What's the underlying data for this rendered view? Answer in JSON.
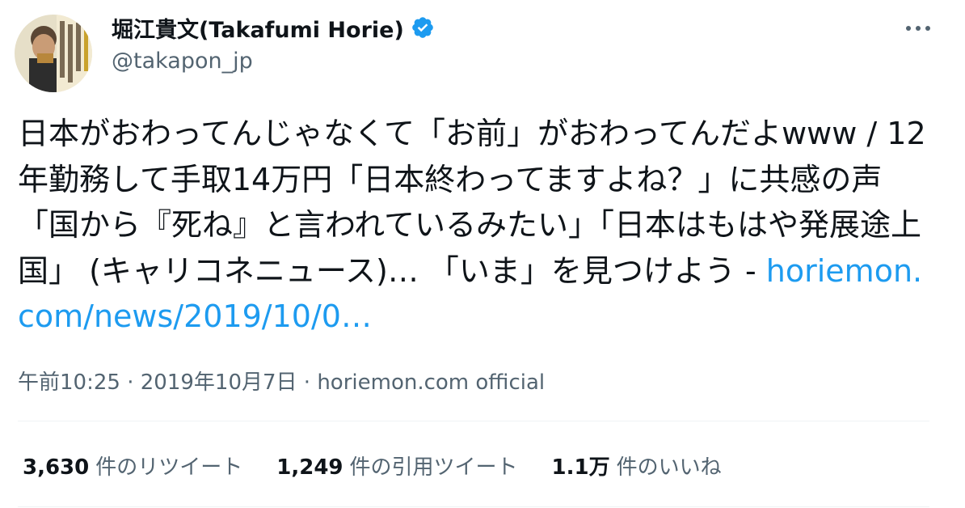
{
  "author": {
    "display_name": "堀江貴文(Takafumi Horie)",
    "handle": "@takapon_jp",
    "verified": true,
    "avatar_icon": "profile-photo-book-cover"
  },
  "tweet": {
    "text": "日本がおわってんじゃなくて「お前」がおわってんだよwww / 12年勤務して手取14万円「日本終わってますよね？」に共感の声　「国から『死ね』と言われているみたい」「日本はもはや発展途上国」 (キャリコネニュース)… 「いま」を見つけよう - ",
    "link_text": "horiemon.com/news/2019/10/0…"
  },
  "meta": {
    "time": "午前10:25",
    "separator1": " · ",
    "date": "2019年10月7日",
    "separator2": " · ",
    "source": "horiemon.com official"
  },
  "stats": {
    "retweets": {
      "count": "3,630",
      "label": "件のリツイート"
    },
    "quotes": {
      "count": "1,249",
      "label": "件の引用ツイート"
    },
    "likes": {
      "count": "1.1万",
      "label": "件のいいね"
    }
  },
  "colors": {
    "link": "#1d9bf0",
    "secondary_text": "#536471",
    "primary_text": "#0f1419",
    "verified_badge": "#1d9bf0",
    "divider": "#eff3f4"
  }
}
